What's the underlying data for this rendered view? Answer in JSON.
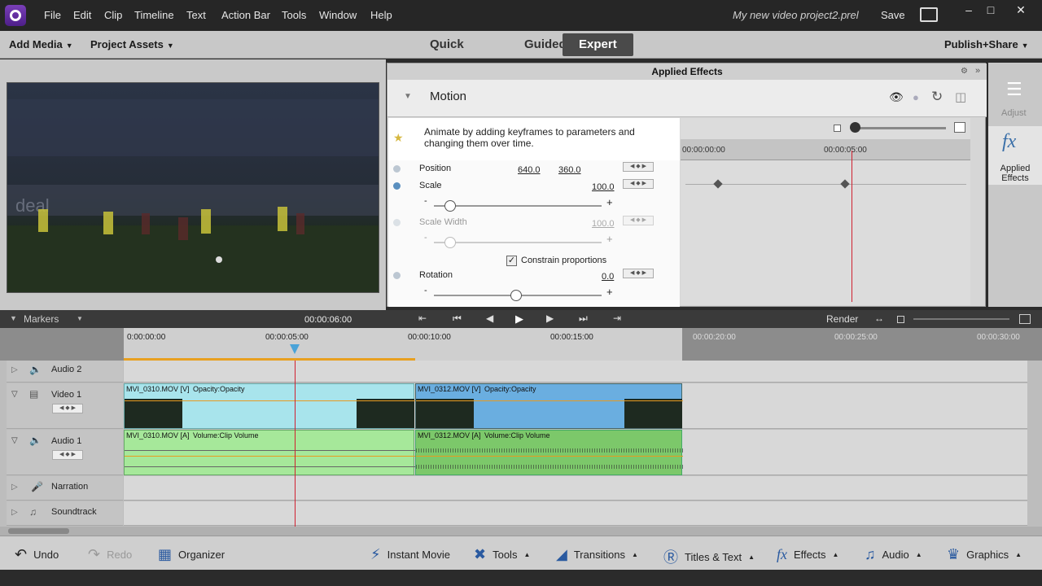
{
  "menu": [
    "File",
    "Edit",
    "Clip",
    "Timeline",
    "Text",
    "Action Bar",
    "Tools",
    "Window",
    "Help"
  ],
  "project_title": "My new video project2.prel",
  "save_label": "Save",
  "toolbar": {
    "add_media": "Add Media",
    "project_assets": "Project Assets",
    "modes": [
      "Quick",
      "Guided",
      "Expert"
    ],
    "active_mode": "Expert",
    "publish_share": "Publish+Share"
  },
  "effects_panel": {
    "title": "Applied Effects",
    "effect_name": "Motion",
    "tip": "Animate by adding keyframes to parameters and changing them over time.",
    "position_label": "Position",
    "position_x": "640.0",
    "position_y": "360.0",
    "scale_label": "Scale",
    "scale_value": "100.0",
    "scale_width_label": "Scale Width",
    "scale_width_value": "100.0",
    "constrain_label": "Constrain proportions",
    "rotation_label": "Rotation",
    "rotation_value": "0.0",
    "minus": "-",
    "plus": "+",
    "kf_time_start": "00:00:00:00",
    "kf_time_mid": "00:00:05:00"
  },
  "right_panel": {
    "adjust": "Adjust",
    "applied_effects": "Applied Effects"
  },
  "timeline": {
    "markers": "Markers",
    "current_time": "00:00:06:00",
    "render": "Render",
    "ruler": [
      "0:00:00:00",
      "00:00:05:00",
      "00:00:10:00",
      "00:00:15:00",
      "00:00:20:00",
      "00:00:25:00",
      "00:00:30:00"
    ],
    "tracks": [
      "Audio 2",
      "Video 1",
      "Audio 1",
      "Narration",
      "Soundtrack"
    ],
    "clips": {
      "v1a": "MVI_0310.MOV [V]",
      "v1a_fx": "Opacity:Opacity",
      "v1b": "MVI_0312.MOV [V]",
      "v1b_fx": "Opacity:Opacity",
      "a1a": "MVI_0310.MOV [A]",
      "a1a_fx": "Volume:Clip Volume",
      "a1b": "MVI_0312.MOV [A]",
      "a1b_fx": "Volume:Clip Volume"
    }
  },
  "actionbar": {
    "undo": "Undo",
    "redo": "Redo",
    "organizer": "Organizer",
    "instant_movie": "Instant Movie",
    "tools": "Tools",
    "transitions": "Transitions",
    "titles_text": "Titles & Text",
    "effects": "Effects",
    "audio": "Audio",
    "graphics": "Graphics"
  },
  "icons": {
    "logo": "premiere-elements-logo",
    "fx": "fx-icon"
  }
}
